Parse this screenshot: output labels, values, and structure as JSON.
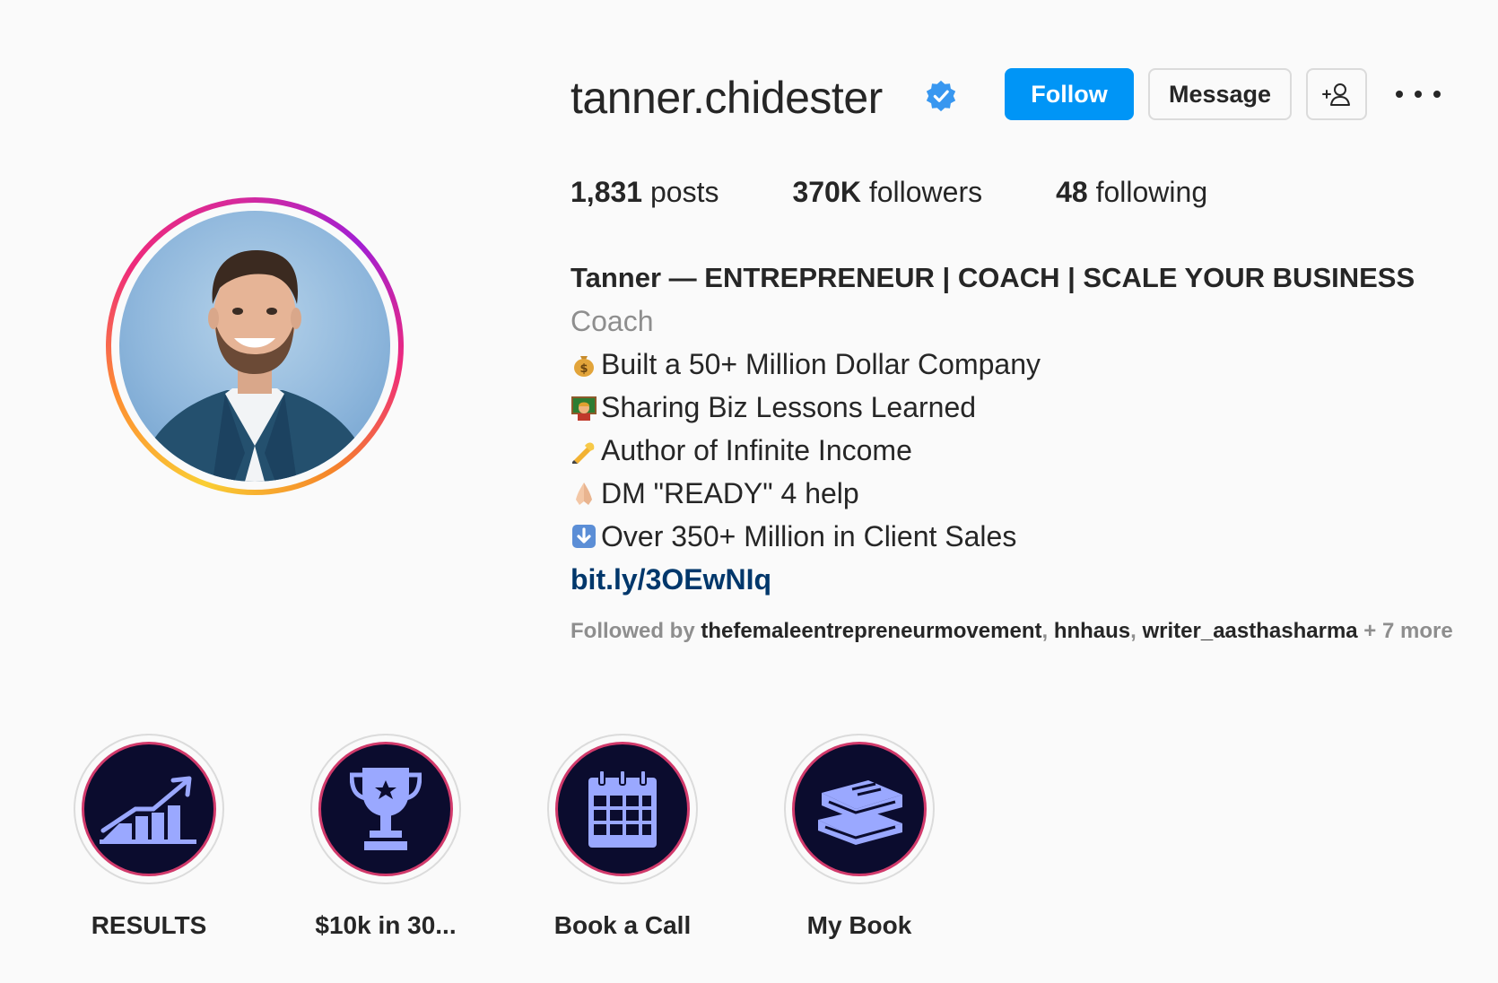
{
  "profile": {
    "username": "tanner.chidester",
    "verified_icon": "verified-badge-icon",
    "avatar_icon": "profile-photo"
  },
  "actions": {
    "follow_label": "Follow",
    "message_label": "Message",
    "add_user_icon": "add-user-icon",
    "more_icon": "more-options-icon"
  },
  "stats": {
    "posts_count": "1,831",
    "posts_label": "posts",
    "followers_count": "370K",
    "followers_label": "followers",
    "following_count": "48",
    "following_label": "following"
  },
  "bio": {
    "full_name": "Tanner — ENTREPRENEUR | COACH | SCALE YOUR BUSINESS",
    "category": "Coach",
    "lines": [
      {
        "emoji": "money-bag-icon",
        "text": "Built a 50+ Million Dollar Company"
      },
      {
        "emoji": "teacher-icon",
        "text": "Sharing Biz Lessons Learned"
      },
      {
        "emoji": "writing-hand-icon",
        "text": "Author of Infinite Income"
      },
      {
        "emoji": "folded-hands-icon",
        "text": "DM \"READY\" 4 help"
      },
      {
        "emoji": "down-arrow-icon",
        "text": "Over 350+ Million in Client Sales"
      }
    ],
    "link": "bit.ly/3OEwNIq"
  },
  "followed_by": {
    "prefix": "Followed by ",
    "names": [
      "thefemaleentrepreneurmovement",
      "hnhaus",
      "writer_aasthasharma"
    ],
    "separator": ", ",
    "suffix": " + 7 more"
  },
  "highlights": [
    {
      "label": "RESULTS",
      "icon": "growth-chart-icon"
    },
    {
      "label": "$10k in 30...",
      "icon": "trophy-icon"
    },
    {
      "label": "Book a Call",
      "icon": "calendar-icon"
    },
    {
      "label": "My Book",
      "icon": "books-icon"
    }
  ],
  "colors": {
    "follow_button": "#0095f6",
    "link": "#00376b",
    "verified": "#3897f0",
    "highlight_bg": "#0b0c2e",
    "highlight_ring": "#d13a6b",
    "highlight_icon": "#9aa8ff"
  }
}
